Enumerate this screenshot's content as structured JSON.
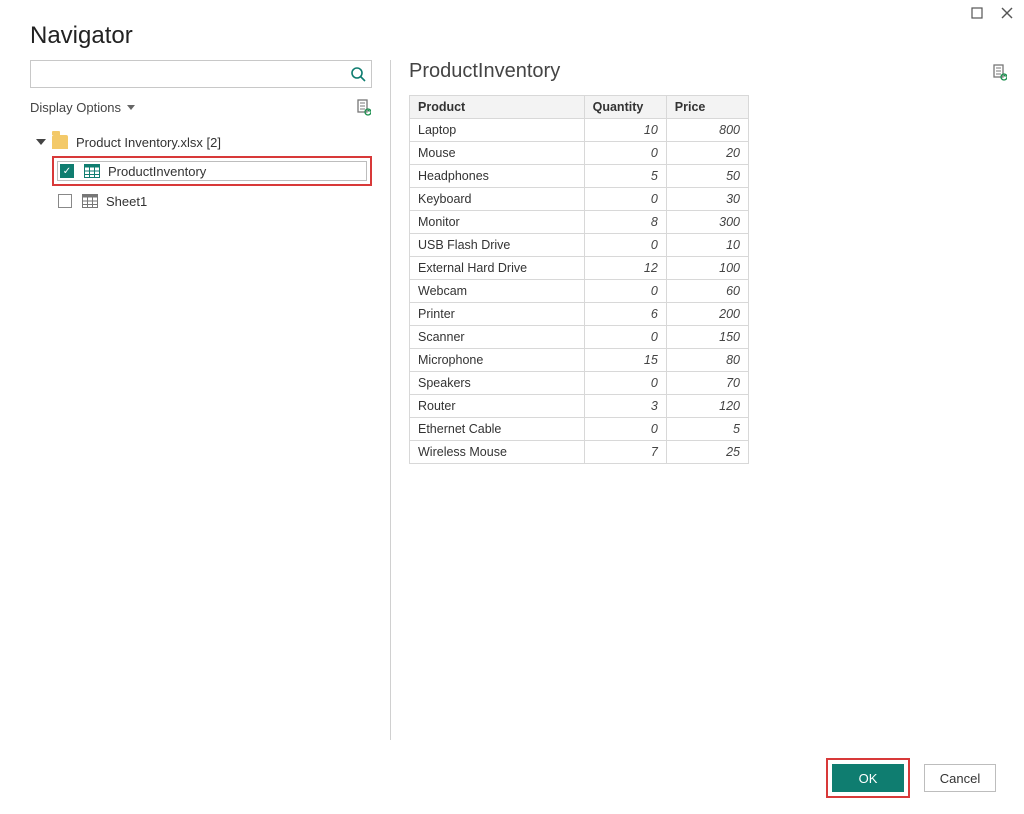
{
  "window": {
    "title": "Navigator"
  },
  "search": {
    "placeholder": ""
  },
  "display_options": {
    "label": "Display Options"
  },
  "tree": {
    "root": {
      "label": "Product Inventory.xlsx [2]"
    },
    "children": [
      {
        "label": "ProductInventory",
        "checked": true,
        "icon": "table-green"
      },
      {
        "label": "Sheet1",
        "checked": false,
        "icon": "sheet-grey"
      }
    ]
  },
  "preview": {
    "title": "ProductInventory",
    "columns": [
      "Product",
      "Quantity",
      "Price"
    ],
    "rows": [
      [
        "Laptop",
        10,
        800
      ],
      [
        "Mouse",
        0,
        20
      ],
      [
        "Headphones",
        5,
        50
      ],
      [
        "Keyboard",
        0,
        30
      ],
      [
        "Monitor",
        8,
        300
      ],
      [
        "USB Flash Drive",
        0,
        10
      ],
      [
        "External Hard Drive",
        12,
        100
      ],
      [
        "Webcam",
        0,
        60
      ],
      [
        "Printer",
        6,
        200
      ],
      [
        "Scanner",
        0,
        150
      ],
      [
        "Microphone",
        15,
        80
      ],
      [
        "Speakers",
        0,
        70
      ],
      [
        "Router",
        3,
        120
      ],
      [
        "Ethernet Cable",
        0,
        5
      ],
      [
        "Wireless Mouse",
        7,
        25
      ]
    ]
  },
  "buttons": {
    "ok": "OK",
    "cancel": "Cancel"
  }
}
